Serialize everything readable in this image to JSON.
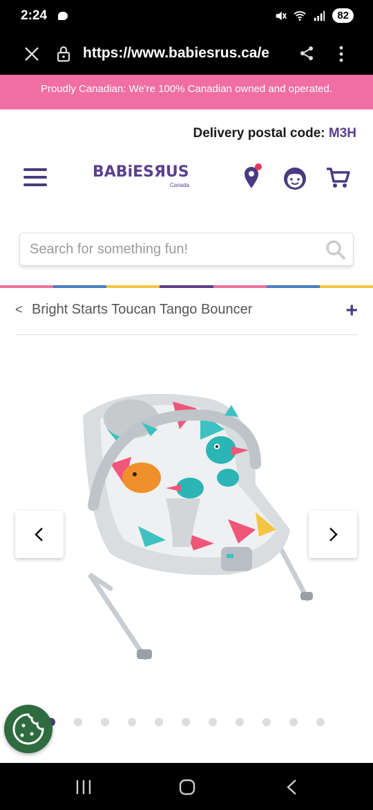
{
  "status_bar": {
    "time": "2:24",
    "battery": "82"
  },
  "browser": {
    "url": "https://www.babiesrus.ca/e"
  },
  "promo": {
    "text": "Proudly Canadian: We're 100% Canadian owned and operated."
  },
  "delivery": {
    "label": "Delivery postal code:",
    "code": "M3H"
  },
  "header": {
    "logo_text": "BABiESЯUS",
    "logo_sub": "Canada"
  },
  "search": {
    "placeholder": "Search for something fun!"
  },
  "breadcrumb": {
    "back": "<",
    "title": "Bright Starts Toucan Tango Bouncer",
    "expand": "+"
  },
  "carousel": {
    "total_dots": 11,
    "active_index": 0
  },
  "colors": {
    "brand_purple": "#4a3a82",
    "promo_pink": "#f06ea3",
    "cookie_green": "#2e6b3f",
    "stripe": [
      "#e8739f",
      "#4a7fc1",
      "#f4c542",
      "#5a3f87",
      "#e8739f",
      "#4a7fc1",
      "#f4c542"
    ]
  },
  "icons": {
    "close": "close-icon",
    "lock": "lock-icon",
    "share": "share-icon",
    "menu": "more-vert-icon",
    "hamburger": "hamburger-menu-icon",
    "location": "location-pin-icon",
    "account": "account-face-icon",
    "cart": "cart-icon",
    "search": "search-icon",
    "cookie": "cookie-icon",
    "prev": "chevron-left-icon",
    "next": "chevron-right-icon"
  }
}
